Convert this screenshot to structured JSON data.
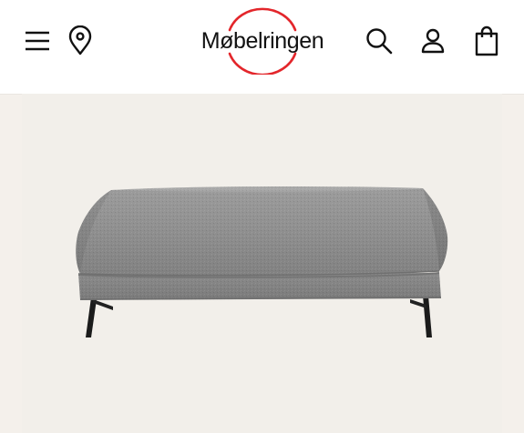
{
  "header": {
    "logo_text": "Møbelringen",
    "brand_color": "#e3262b",
    "icons": [
      "menu-icon",
      "location-icon",
      "search-icon",
      "account-icon",
      "shopping-bag-icon"
    ]
  },
  "product": {
    "image": "grey-upholstered-ottoman-bench",
    "image_background": "#f2efea"
  },
  "colors": {
    "page_background": "#f4f0eb",
    "header_background": "#ffffff",
    "icon_color": "#111111"
  }
}
